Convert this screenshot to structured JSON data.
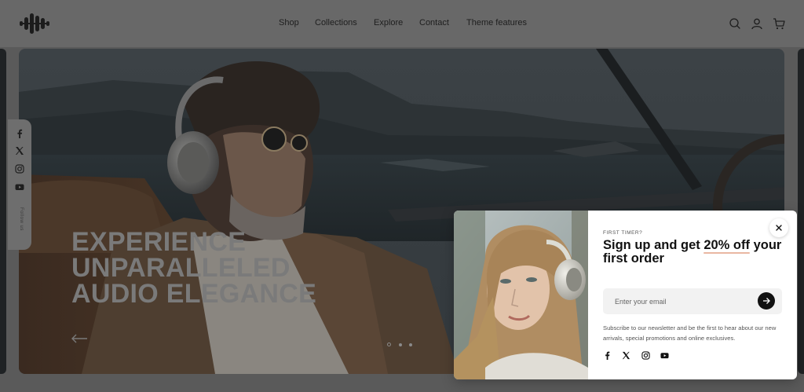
{
  "header": {
    "nav": [
      {
        "label": "Shop"
      },
      {
        "label": "Collections"
      },
      {
        "label": "Explore"
      },
      {
        "label": "Contact"
      },
      {
        "label": "Theme features"
      }
    ],
    "icons": [
      "search-icon",
      "account-icon",
      "cart-icon"
    ]
  },
  "hero": {
    "title_lines": [
      "EXPERIENCE",
      "UNPARALLELED",
      "AUDIO ELEGANCE"
    ],
    "slides": 3,
    "active_slide": 1
  },
  "social_bar": {
    "icons": [
      "facebook-icon",
      "x-icon",
      "instagram-icon",
      "youtube-icon"
    ],
    "follow_label": "Follow us"
  },
  "popup": {
    "eyebrow": "FIRST TIMER?",
    "heading_pre": "Sign up and get ",
    "heading_highlight": "20% off",
    "heading_post": " your first order",
    "email_placeholder": "Enter your email",
    "description": "Subscribe to our newsletter and be the first to hear about our new arrivals, special promotions and online exclusives.",
    "social_icons": [
      "facebook-icon",
      "x-icon",
      "instagram-icon",
      "youtube-icon"
    ]
  },
  "colors": {
    "overlay": "#5a5a5a",
    "popup_bg": "#ffffff",
    "accent_underline": "#e9b7a2",
    "submit_button": "#111111"
  }
}
